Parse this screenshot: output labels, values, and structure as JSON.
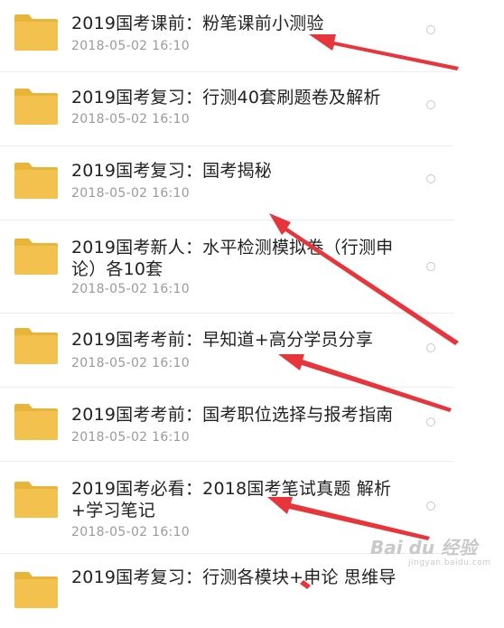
{
  "files": [
    {
      "name": "2019国考课前：粉笔课前小测验",
      "date": "2018-05-02  16:10"
    },
    {
      "name": "2019国考复习：行测40套刷题卷及解析",
      "date": "2018-05-02  16:10"
    },
    {
      "name": "2019国考复习：国考揭秘",
      "date": "2018-05-02  16:10"
    },
    {
      "name": "2019国考新人：水平检测模拟卷（行测申论）各10套",
      "date": "2018-05-02  16:10"
    },
    {
      "name": "2019国考考前：早知道+高分学员分享",
      "date": "2018-05-02  16:10"
    },
    {
      "name": "2019国考考前：国考职位选择与报考指南",
      "date": "2018-05-02  16:10"
    },
    {
      "name": "2019国考必看：2018国考笔试真题 解析+学习笔记",
      "date": "2018-05-02  16:10"
    },
    {
      "name": "2019国考复习：行测各模块+申论 思维导",
      "date": ""
    }
  ],
  "watermark": {
    "text": "Bai du 经验",
    "sub": "jingyan.baidu.com"
  },
  "colors": {
    "folder": "#f2c14e",
    "folder_tab": "#e9b43a",
    "arrow": "#e8343b",
    "text": "#222222",
    "date": "#9a9a9a"
  }
}
